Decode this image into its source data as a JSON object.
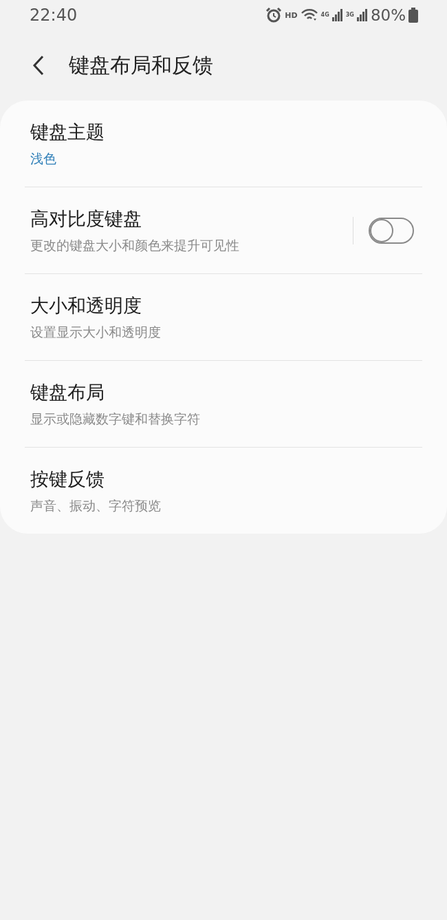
{
  "status_bar": {
    "time": "22:40",
    "hd": "HD",
    "network_1": "4G",
    "network_2": "3G",
    "battery": "80%"
  },
  "header": {
    "title": "键盘布局和反馈"
  },
  "settings": [
    {
      "kind": "value",
      "title": "键盘主题",
      "summary": "浅色"
    },
    {
      "kind": "switch",
      "title": "高对比度键盘",
      "summary": "更改的键盘大小和颜色来提升可见性",
      "on": false
    },
    {
      "kind": "nav",
      "title": "大小和透明度",
      "summary": "设置显示大小和透明度"
    },
    {
      "kind": "nav",
      "title": "键盘布局",
      "summary": "显示或隐藏数字键和替换字符"
    },
    {
      "kind": "nav",
      "title": "按键反馈",
      "summary": "声音、振动、字符预览"
    }
  ]
}
